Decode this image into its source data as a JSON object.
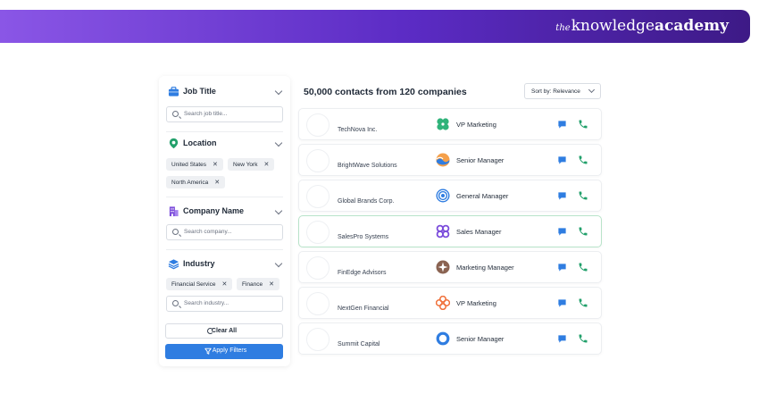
{
  "brand": {
    "prefix": "the",
    "name": "knowledge",
    "name_bold": "academy"
  },
  "filters": {
    "job_title": {
      "title": "Job Title",
      "placeholder": "Search job title..."
    },
    "location": {
      "title": "Location",
      "chips": [
        "United States",
        "New York",
        "North America"
      ]
    },
    "company_name": {
      "title": "Company Name",
      "placeholder": "Search company..."
    },
    "industry": {
      "title": "Industry",
      "chips": [
        "Financial Service",
        "Finance"
      ],
      "placeholder": "Search industry..."
    },
    "clear_label": "Clear All",
    "apply_label": "Apply Filters",
    "chip_remove": "✕"
  },
  "results": {
    "title": "50,000 contacts from 120 companies",
    "sort_label": "Sort by: Relevance",
    "rows": [
      {
        "company": "TechNova Inc.",
        "role": "VP Marketing",
        "logo": "green-clover-icon"
      },
      {
        "company": "BrightWave Solutions",
        "role": "Senior Manager",
        "logo": "orange-wave-icon"
      },
      {
        "company": "Global Brands Corp.",
        "role": "General Manager",
        "logo": "blue-ring-icon"
      },
      {
        "company": "SalesPro Systems",
        "role": "Sales Manager",
        "logo": "purple-loops-icon"
      },
      {
        "company": "FinEdge Advisors",
        "role": "Marketing Manager",
        "logo": "brown-star-icon"
      },
      {
        "company": "NextGen Financial",
        "role": "VP Marketing",
        "logo": "orange-flower-icon"
      },
      {
        "company": "Summit Capital",
        "role": "Senior Manager",
        "logo": "blue-ring-icon"
      }
    ]
  },
  "colors": {
    "accent": "#2f7de1",
    "phone": "#22a06b",
    "chat": "#2f7de1",
    "banner_start": "#8a56e6",
    "banner_end": "#3d1a86"
  }
}
